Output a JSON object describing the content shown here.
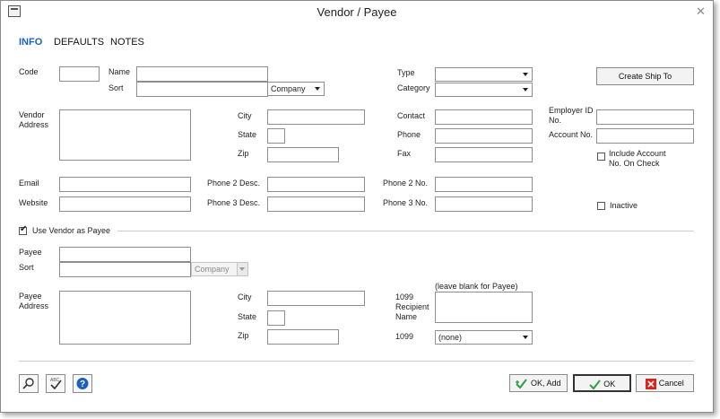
{
  "window": {
    "title": "Vendor / Payee"
  },
  "tabs": [
    {
      "label": "INFO",
      "active": true
    },
    {
      "label": "DEFAULTS",
      "active": false
    },
    {
      "label": "NOTES",
      "active": false
    }
  ],
  "vendor": {
    "code_label": "Code",
    "name_label": "Name",
    "sort_label": "Sort",
    "sort_type_value": "Company",
    "type_label": "Type",
    "category_label": "Category",
    "create_ship_to_label": "Create Ship To",
    "address_label": "Vendor Address",
    "city_label": "City",
    "state_label": "State",
    "zip_label": "Zip",
    "contact_label": "Contact",
    "phone_label": "Phone",
    "fax_label": "Fax",
    "employer_id_label": "Employer ID No.",
    "account_no_label": "Account No.",
    "include_account_label": "Include Account No. On Check",
    "include_account_checked": false,
    "email_label": "Email",
    "website_label": "Website",
    "phone2_desc_label": "Phone 2 Desc.",
    "phone3_desc_label": "Phone 3 Desc.",
    "phone2_no_label": "Phone 2 No.",
    "phone3_no_label": "Phone 3 No.",
    "inactive_label": "Inactive",
    "inactive_checked": false
  },
  "payee": {
    "use_vendor_label": "Use Vendor as Payee",
    "use_vendor_checked": true,
    "payee_label": "Payee",
    "sort_label": "Sort",
    "sort_type_value": "Company",
    "address_label": "Payee Address",
    "city_label": "City",
    "state_label": "State",
    "zip_label": "Zip",
    "recipient_label": "1099 Recipient Name",
    "recipient_hint": "(leave blank for Payee)",
    "form1099_label": "1099",
    "form1099_value": "(none)"
  },
  "footer": {
    "ok_add_label": "OK, Add",
    "ok_label": "OK",
    "cancel_label": "Cancel"
  },
  "icons": {
    "search": "search-icon",
    "spellcheck": "spellcheck-icon",
    "help": "help-icon",
    "accent_blue": "#1f5fbf",
    "ok_green": "#2e9e3e",
    "cancel_red": "#d9261c"
  }
}
